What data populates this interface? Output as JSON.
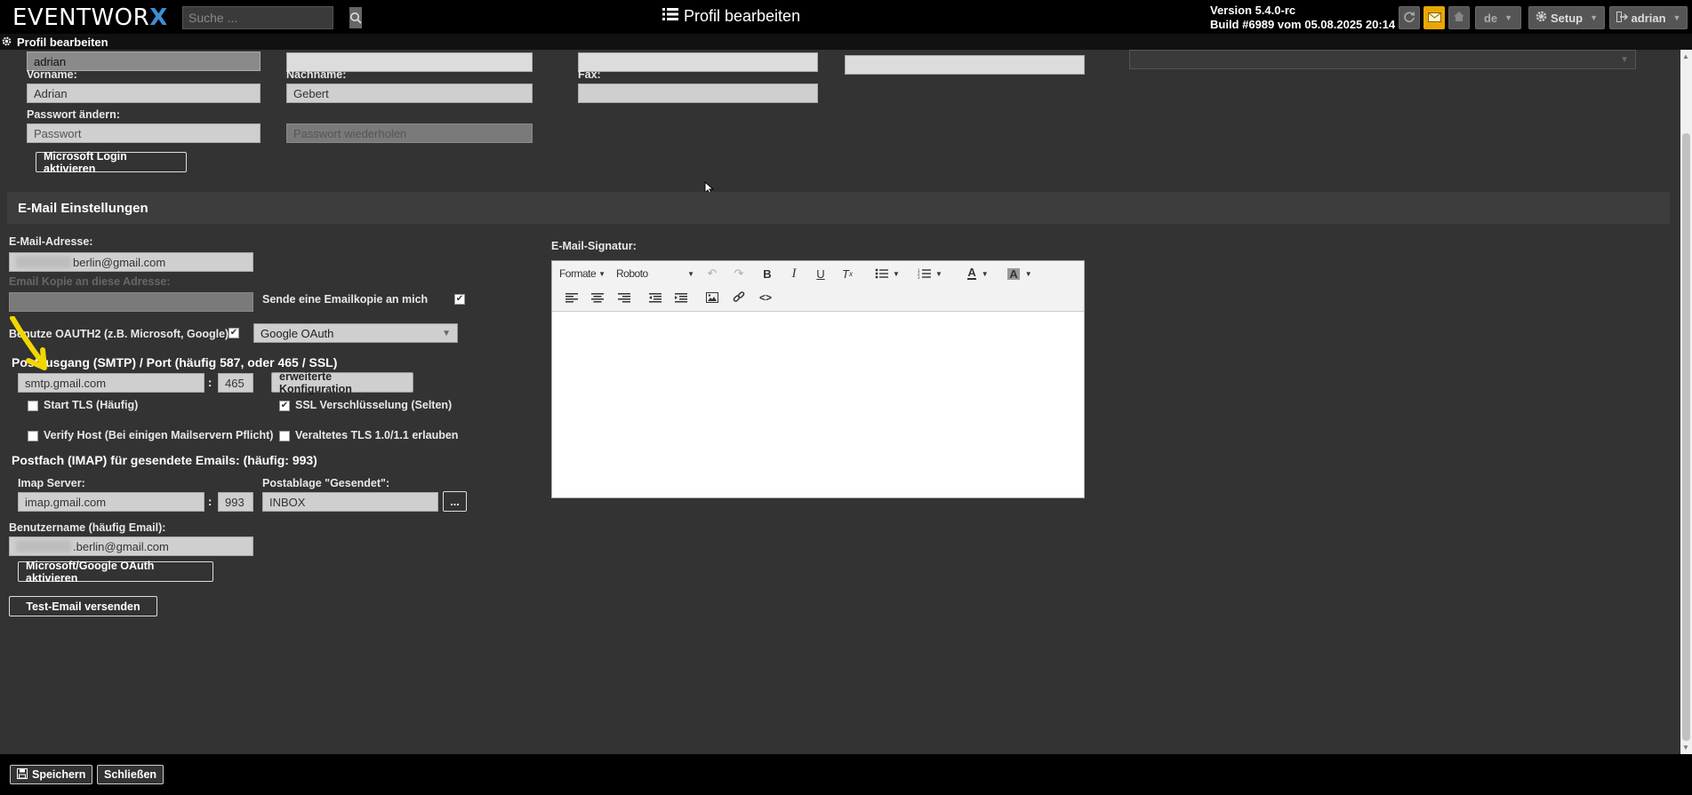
{
  "app": {
    "logo_text": "EVENTWOR",
    "logo_x": "X",
    "search_placeholder": "Suche ...",
    "page_title": "Profil bearbeiten",
    "version": "Version 5.4.0-rc",
    "build": "Build #6989 vom 05.08.2025 20:14",
    "language": "de",
    "setup_label": "Setup",
    "user_label": "adrian"
  },
  "subheader": {
    "title": "Profil bearbeiten"
  },
  "profile": {
    "username_value": "adrian",
    "firstname_label": "Vorname:",
    "firstname_value": "Adrian",
    "lastname_label": "Nachname:",
    "lastname_value": "Gebert",
    "fax_label": "Fax:",
    "password_label": "Passwort ändern:",
    "password_placeholder": "Passwort",
    "password_repeat_placeholder": "Passwort wiederholen",
    "ms_login_button": "Microsoft Login aktivieren"
  },
  "email": {
    "section_title": "E-Mail Einstellungen",
    "address_label": "E-Mail-Adresse:",
    "address_value": "berlin@gmail.com",
    "copy_label": "Email Kopie an diese Adresse:",
    "send_copy_label": "Sende eine Emailkopie an mich",
    "oauth_label": "Benutze OAUTH2 (z.B. Microsoft, Google)",
    "oauth_provider": "Google OAuth",
    "smtp_title": "Postausgang (SMTP) / Port (häufig 587, oder 465 / SSL)",
    "smtp_server": "smtp.gmail.com",
    "smtp_port": "465",
    "advanced_button": "erweiterte Konfiguration",
    "start_tls_label": "Start TLS (Häufig)",
    "ssl_label": "SSL Verschlüsselung (Selten)",
    "verify_host_label": "Verify Host (Bei einigen Mailservern Pflicht)",
    "old_tls_label": "Veraltetes TLS 1.0/1.1 erlauben",
    "imap_title": "Postfach (IMAP) für gesendete Emails: (häufig: 993)",
    "imap_server_label": "Imap Server:",
    "imap_server": "imap.gmail.com",
    "imap_port": "993",
    "sent_folder_label": "Postablage \"Gesendet\":",
    "sent_folder": "INBOX",
    "browse_button": "...",
    "username_label": "Benutzername (häufig Email):",
    "username_value": ".berlin@gmail.com",
    "oauth_button": "Microsoft/Google OAuth aktivieren",
    "test_button": "Test-Email versenden",
    "signature_label": "E-Mail-Signatur:",
    "editor_formats": "Formate",
    "editor_font": "Roboto"
  },
  "footer": {
    "save_label": "Speichern",
    "close_label": "Schließen"
  },
  "colors": {
    "accent_mail": "#e8a800",
    "logo_x": "#3d8fd6",
    "annotation_arrow": "#f2d600"
  }
}
